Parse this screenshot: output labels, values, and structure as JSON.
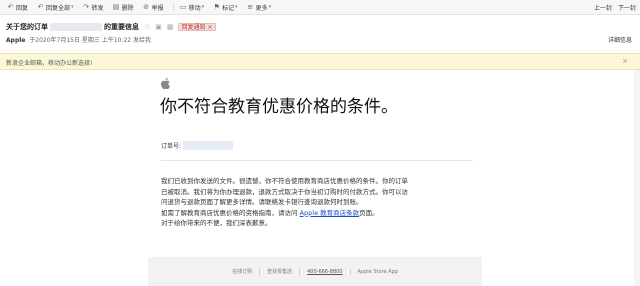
{
  "toolbar": {
    "items": [
      {
        "icon": "reply-icon",
        "label": "回复"
      },
      {
        "icon": "reply-all-icon",
        "label": "回复全部"
      },
      {
        "icon": "forward-icon",
        "label": "转发"
      },
      {
        "icon": "delete-icon",
        "label": "删除"
      },
      {
        "icon": "report-icon",
        "label": "举报"
      },
      {
        "icon": "move-icon",
        "label": "移动"
      },
      {
        "icon": "mark-icon",
        "label": "标记"
      },
      {
        "icon": "more-icon",
        "label": "更多"
      }
    ],
    "prev": "上一封",
    "next": "下一封"
  },
  "header": {
    "subject_prefix": "关于您的订单",
    "subject_suffix": "的重要信息",
    "flag": "回复通知",
    "from_name": "Apple",
    "date_text": "于2020年7月15日 星期三 上午10:22 发给我",
    "detail": "详细信息"
  },
  "notice": {
    "text": "新浪企业邮箱，移动办公新选择!",
    "close": "×"
  },
  "mail": {
    "title": "你不符合教育优惠价格的条件。",
    "order_label": "订单号:",
    "para": [
      "我们已收到你发送的文件。很遗憾，你不符合使用教育商店优惠价格的条件。你的订单",
      "已被取消。我们将为你办理退款，退款方式取决于你当初订购时的付款方式。你可以访",
      "问退货与退款页面了解更多详情。请联络发卡银行查询退款何时到账。"
    ],
    "line4_pre": "如需了解教育商店优惠价格的资格指南，请访问 ",
    "line4_link": "Apple 教育商店条款",
    "line4_post": "页面。",
    "line5": "对于给你带来的不便，我们深表歉意。"
  },
  "footer": {
    "items": [
      "在线订购",
      "查找零售店",
      "400-666-8800",
      "Apple Store App"
    ]
  }
}
